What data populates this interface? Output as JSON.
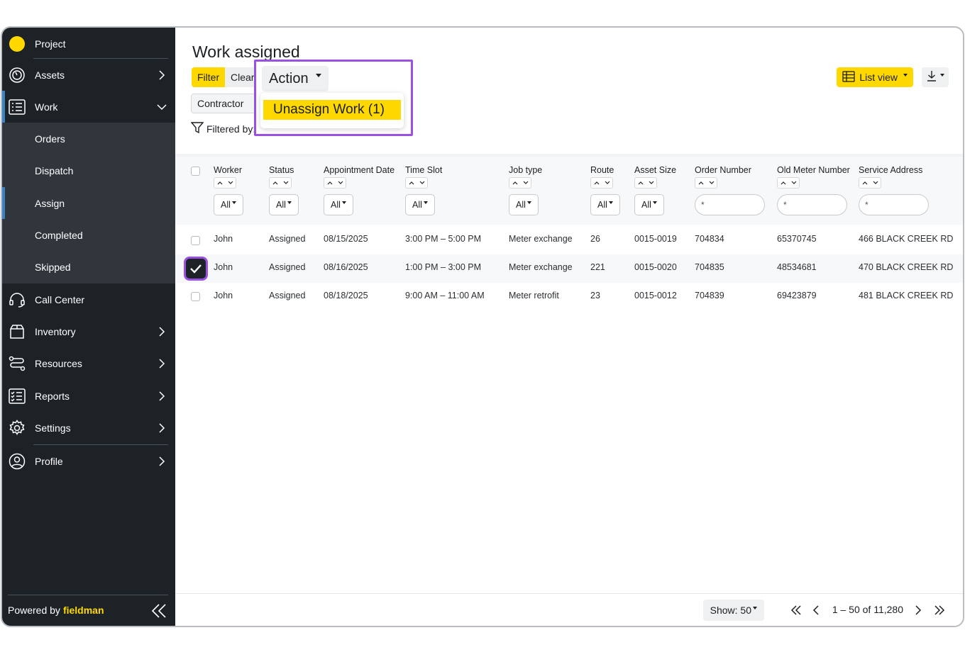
{
  "sidebar": {
    "project": "Project",
    "items": [
      {
        "label": "Assets",
        "icon": "gauge-icon"
      },
      {
        "label": "Work",
        "icon": "list-icon"
      },
      {
        "label": "Call Center",
        "icon": "headset-icon"
      },
      {
        "label": "Inventory",
        "icon": "box-icon"
      },
      {
        "label": "Resources",
        "icon": "route-icon"
      },
      {
        "label": "Reports",
        "icon": "checklist-icon"
      },
      {
        "label": "Settings",
        "icon": "gear-icon"
      },
      {
        "label": "Profile",
        "icon": "user-circle-icon"
      }
    ],
    "work_sub": [
      "Orders",
      "Dispatch",
      "Assign",
      "Completed",
      "Skipped"
    ],
    "powered_by": "Powered by",
    "brand": "fieldman"
  },
  "main": {
    "title": "Work assigned",
    "filter_label": "Filter",
    "clear_label": "Clear",
    "action_label": "Action",
    "menu_item": "Unassign Work (1)",
    "contractor": "Contractor",
    "filtered_by": "Filtered by:",
    "list_view": "List view"
  },
  "table": {
    "headers": [
      "Worker",
      "Status",
      "Appointment Date",
      "Time Slot",
      "Job type",
      "Route",
      "Asset Size",
      "Order Number",
      "Old Meter Number",
      "Service Address"
    ],
    "filter_all": "All",
    "search_placeholder": "*",
    "rows": [
      [
        "John",
        "Assigned",
        "08/15/2025",
        "3:00 PM – 5:00 PM",
        "Meter exchange",
        "26",
        "0015-0019",
        "704834",
        "65370745",
        "466 BLACK CREEK RD"
      ],
      [
        "John",
        "Assigned",
        "08/16/2025",
        "1:00 PM – 3:00 PM",
        "Meter exchange",
        "221",
        "0015-0020",
        "704835",
        "48534681",
        "470 BLACK CREEK RD"
      ],
      [
        "John",
        "Assigned",
        "08/18/2025",
        "9:00 AM – 11:00 AM",
        "Meter retrofit",
        "23",
        "0015-0012",
        "704839",
        "69423879",
        "481 BLACK CREEK RD"
      ]
    ]
  },
  "footer": {
    "show": "Show: 50",
    "range": "1 – 50 of 11,280"
  },
  "colors": {
    "accent": "#ffd800",
    "highlight": "#9b51e0",
    "sidebar": "#1d2227"
  }
}
